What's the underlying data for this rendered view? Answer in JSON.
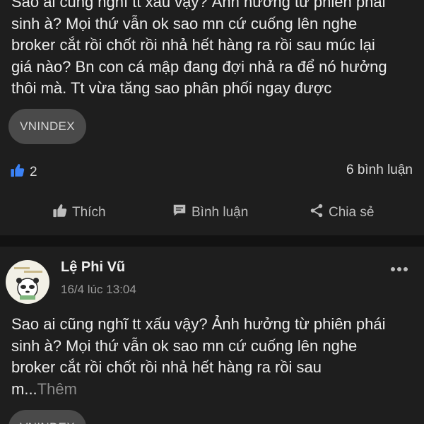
{
  "post1": {
    "text": "Sao ai cũng nghĩ tt xấu vậy? Ảnh hưởng từ phiên phái\nsinh à? Mọi thứ vẫn ok sao mn cứ cuống lên nghe\nbroker cắt rồi chốt rồi nhả hết hàng ra rồi sau múc lại\ngiá nào? Bn con cá mập đang đợi nhả ra để nó hưởng\nthôi mà. Tt vừa tăng sao phân phối ngay được",
    "tag": "VNINDEX",
    "like_count": "2",
    "comment_count": "6 bình luận",
    "actions": {
      "like": "Thích",
      "comment": "Bình luận",
      "share": "Chia sẻ"
    }
  },
  "post2": {
    "author": "Lệ Phi Vũ",
    "time": "16/4 lúc 13:04",
    "text": "Sao ai cũng nghĩ tt xấu vậy? Ảnh hưởng từ phiên phái\nsinh à? Mọi thứ vẫn ok sao mn cứ cuống lên nghe\nbroker cắt rồi chốt rồi nhả hết hàng ra rồi sau\nm...",
    "more_label": "Thêm",
    "tag": "VNINDEX"
  },
  "icons": {
    "like": "thumbs-up-icon",
    "comment": "speech-bubble-icon",
    "share": "share-icon",
    "more": "more-dots-icon"
  },
  "colors": {
    "background": "#121212",
    "card": "#1e1e1e",
    "like_blue": "#3b82f6",
    "tag_bg": "#4a4a4a"
  }
}
